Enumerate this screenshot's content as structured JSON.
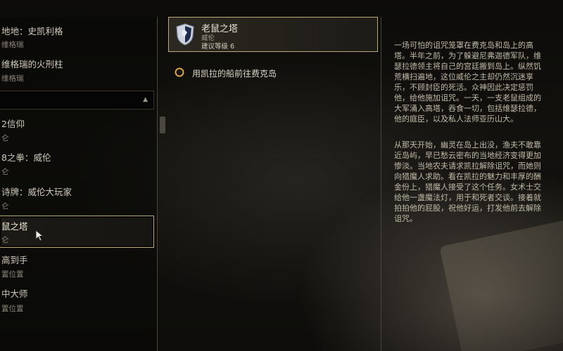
{
  "quest_list": {
    "rows": [
      {
        "label": "地地：史凯利格",
        "sub": "维格瑞"
      },
      {
        "label": "维格瑞的火刑柱",
        "sub": "维格瑞"
      },
      {
        "label": "2信仰",
        "sub": "仑"
      },
      {
        "label": "8之拳：威伦",
        "sub": "仑"
      },
      {
        "label": "诗牌：威伦大玩家",
        "sub": "仑"
      },
      {
        "label": "鼠之塔",
        "sub": "仑"
      },
      {
        "label": "高到手",
        "sub": "置位置"
      },
      {
        "label": "中大师",
        "sub": "置位置"
      }
    ]
  },
  "quest_detail": {
    "title": "老鼠之塔",
    "giver": "威伦",
    "level": "建议等级 6",
    "objective": "用凯拉的船前往费克岛"
  },
  "description": {
    "p1": "一场可怕的诅咒笼罩在费克岛和岛上的高\n塔。半年之前，为了躲避尼弗迦德军队，维\n瑟拉德领主将自己的宫廷搬到岛上。纵然饥\n荒横扫遍地，这位威伦之主却仍然沉迷享\n乐，不顾封臣的死活。众神因此决定惩罚\n他，给他施加诅咒。一天，一支老鼠组成的\n大军涌入高塔，吞食一切，包括维瑟拉德，\n他的庭臣，以及私人法师亚历山大。",
    "p2": "从那天开始，幽灵在岛上出没，渔夫不敢靠\n近岛屿，早已愁云密布的当地经济变得更加\n惨淡。当地农夫请求凯拉解除诅咒，而她则\n向猎魔人求助。看在凯拉的魅力和丰厚的酬\n金份上，猎魔人接受了这个任务。女术士交\n给他一盏魔法灯，用于和死者交谈。接着就\n拍拍他的屁股，祝他好运，打发他前去解除\n诅咒。"
  },
  "colors": {
    "accent_border": "#b9a878",
    "panel_border": "#4a4538",
    "text_main": "#dcd5c6",
    "text_dim": "#8a8476"
  },
  "icons": {
    "quest_shield": "shield-icon",
    "objective_marker": "objective-marker-icon",
    "cursor": "cursor-icon",
    "dropdown": "chevron-up-icon"
  }
}
